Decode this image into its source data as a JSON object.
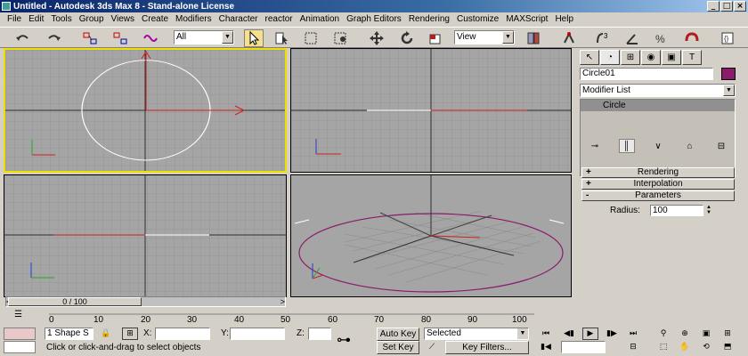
{
  "window": {
    "title": "Untitled - Autodesk 3ds Max 8 - Stand-alone License"
  },
  "menu": [
    "File",
    "Edit",
    "Tools",
    "Group",
    "Views",
    "Create",
    "Modifiers",
    "Character",
    "reactor",
    "Animation",
    "Graph Editors",
    "Rendering",
    "Customize",
    "MAXScript",
    "Help"
  ],
  "toolbar": {
    "selection_filter": "All",
    "coordinate_system": "View"
  },
  "command_panel": {
    "object_name": "Circle01",
    "object_color": "#8b1a6b",
    "modifier_list": "Modifier List",
    "stack_items": [
      "Circle"
    ],
    "rollouts": [
      {
        "sign": "+",
        "label": "Rendering"
      },
      {
        "sign": "+",
        "label": "Interpolation"
      },
      {
        "sign": "-",
        "label": "Parameters"
      }
    ],
    "params": {
      "radius_label": "Radius:",
      "radius_value": "100"
    }
  },
  "time": {
    "slider_text": "0 / 100",
    "ticks": [
      "0",
      "10",
      "20",
      "30",
      "40",
      "50",
      "60",
      "70",
      "80",
      "90",
      "100"
    ]
  },
  "status": {
    "selection": "1 Shape S",
    "x_label": "X:",
    "y_label": "Y:",
    "z_label": "Z:",
    "prompt": "Click or click-and-drag to select objects",
    "auto_key": "Auto Key",
    "set_key": "Set Key",
    "key_mode": "Selected",
    "key_filters": "Key Filters..."
  },
  "colors": {
    "active_viewport": "#f0e000",
    "x_axis": "#cc2020",
    "y_axis": "#20aa20",
    "z_axis": "#2040cc",
    "circle": "#ffffff",
    "ground_circle": "#8b1a6b"
  }
}
